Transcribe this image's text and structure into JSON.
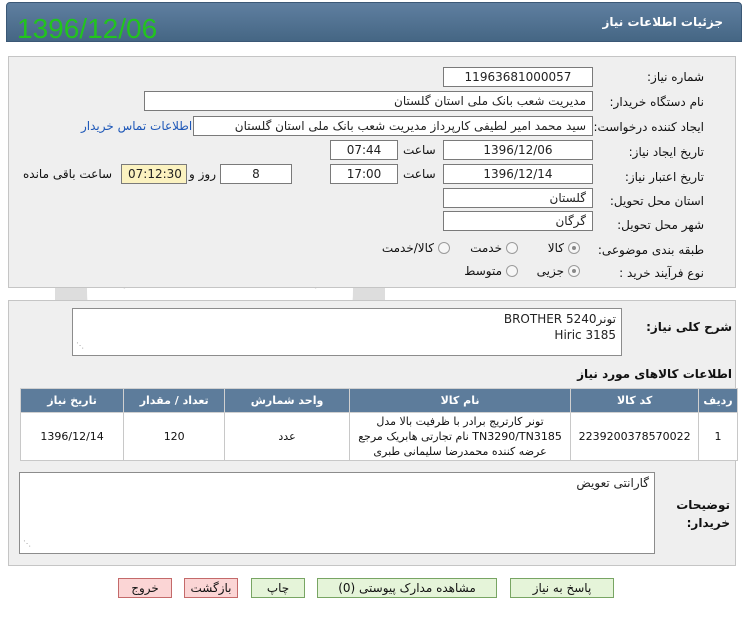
{
  "header": {
    "title": "جزئیات اطلاعات نیاز",
    "date_overlay": "1396/12/06"
  },
  "form": {
    "need_number_label": "شماره نیاز:",
    "need_number": "11963681000057",
    "buyer_org_label": "نام دستگاه خریدار:",
    "buyer_org": "مدیریت شعب بانک ملی استان گلستان",
    "requester_label": "ایجاد کننده درخواست:",
    "requester": "سید محمد امیر لطیفی کارپرداز مدیریت شعب بانک ملی استان گلستان",
    "contact_link": "اطلاعات تماس خریدار",
    "created_label": "تاریخ ایجاد نیاز:",
    "created_date": "1396/12/06",
    "time_label": "ساعت",
    "created_time": "07:44",
    "validity_label": "تاریخ اعتبار نیاز:",
    "validity_date": "1396/12/14",
    "validity_time": "17:00",
    "days": "8",
    "days_label": "روز و",
    "remaining": "07:12:30",
    "remaining_label": "ساعت باقی مانده",
    "province_label": "استان محل تحویل:",
    "province": "گلستان",
    "city_label": "شهر محل تحویل:",
    "city": "گرگان",
    "category_label": "طبقه بندی موضوعی:",
    "category_options": [
      "کالا",
      "خدمت",
      "کالا/خدمت"
    ],
    "category_selected": "کالا",
    "process_label": "نوع فرآیند خرید :",
    "process_options": [
      "جزیی",
      "متوسط"
    ],
    "process_selected": "جزیی"
  },
  "description": {
    "label": "شرح کلی نیاز:",
    "line1": "تونرBROTHER 5240",
    "line2": "Hiric 3185"
  },
  "items": {
    "title": "اطلاعات کالاهای مورد نیاز",
    "columns": [
      "ردیف",
      "کد کالا",
      "نام کالا",
      "واحد شمارش",
      "تعداد / مقدار",
      "تاریخ نیاز"
    ],
    "rows": [
      {
        "index": "1",
        "code": "2239200378570022",
        "name": "تونر کارتریج برادر با ظرفیت بالا مدل TN3290/TN3185 نام تجارتی هابریک مرجع عرضه کننده محمدرضا سلیمانی طبری",
        "unit": "عدد",
        "qty": "120",
        "date": "1396/12/14"
      }
    ]
  },
  "buyer_notes": {
    "label_line1": "توضیحات",
    "label_line2": "خریدار:",
    "text": "گارانتی تعویض"
  },
  "buttons": {
    "reply": "پاسخ به نیاز",
    "attachments": "مشاهده مدارک پیوستی (0)",
    "print": "چاپ",
    "back": "بازگشت",
    "exit": "خروج"
  }
}
